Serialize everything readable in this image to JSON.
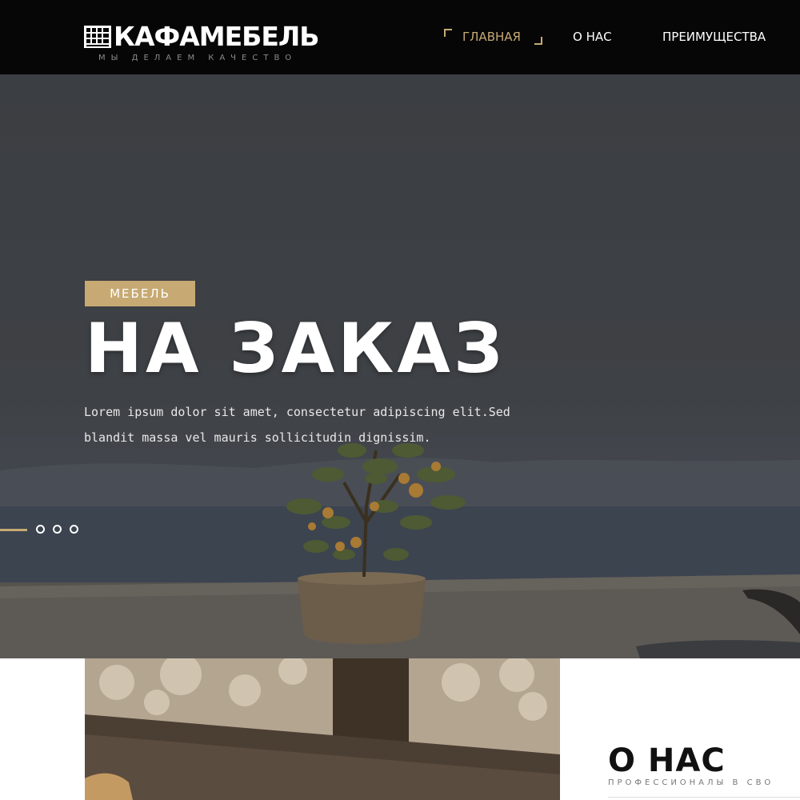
{
  "header": {
    "logo_text": "КАФАМЕБЕЛЬ",
    "tagline": "МЫ ДЕЛАЕМ КАЧЕСТВО",
    "nav": [
      {
        "label": "ГЛАВНАЯ",
        "active": true
      },
      {
        "label": "О НАС",
        "active": false
      },
      {
        "label": "ПРЕИМУЩЕСТВА",
        "active": false
      }
    ]
  },
  "hero": {
    "badge": "МЕБЕЛЬ",
    "title": "НА ЗАКАЗ",
    "text": "Lorem ipsum dolor sit amet, consectetur adipiscing elit.Sed blandit massa vel mauris sollicitudin dignissim.",
    "slides_count": 3
  },
  "about": {
    "title": "О НАС",
    "subtitle": "ПРОФЕССИОНАЛЫ В СВО"
  },
  "colors": {
    "accent": "#c7aa73",
    "header_bg": "#060606"
  },
  "icons": {
    "logo": "grid-table-icon"
  }
}
